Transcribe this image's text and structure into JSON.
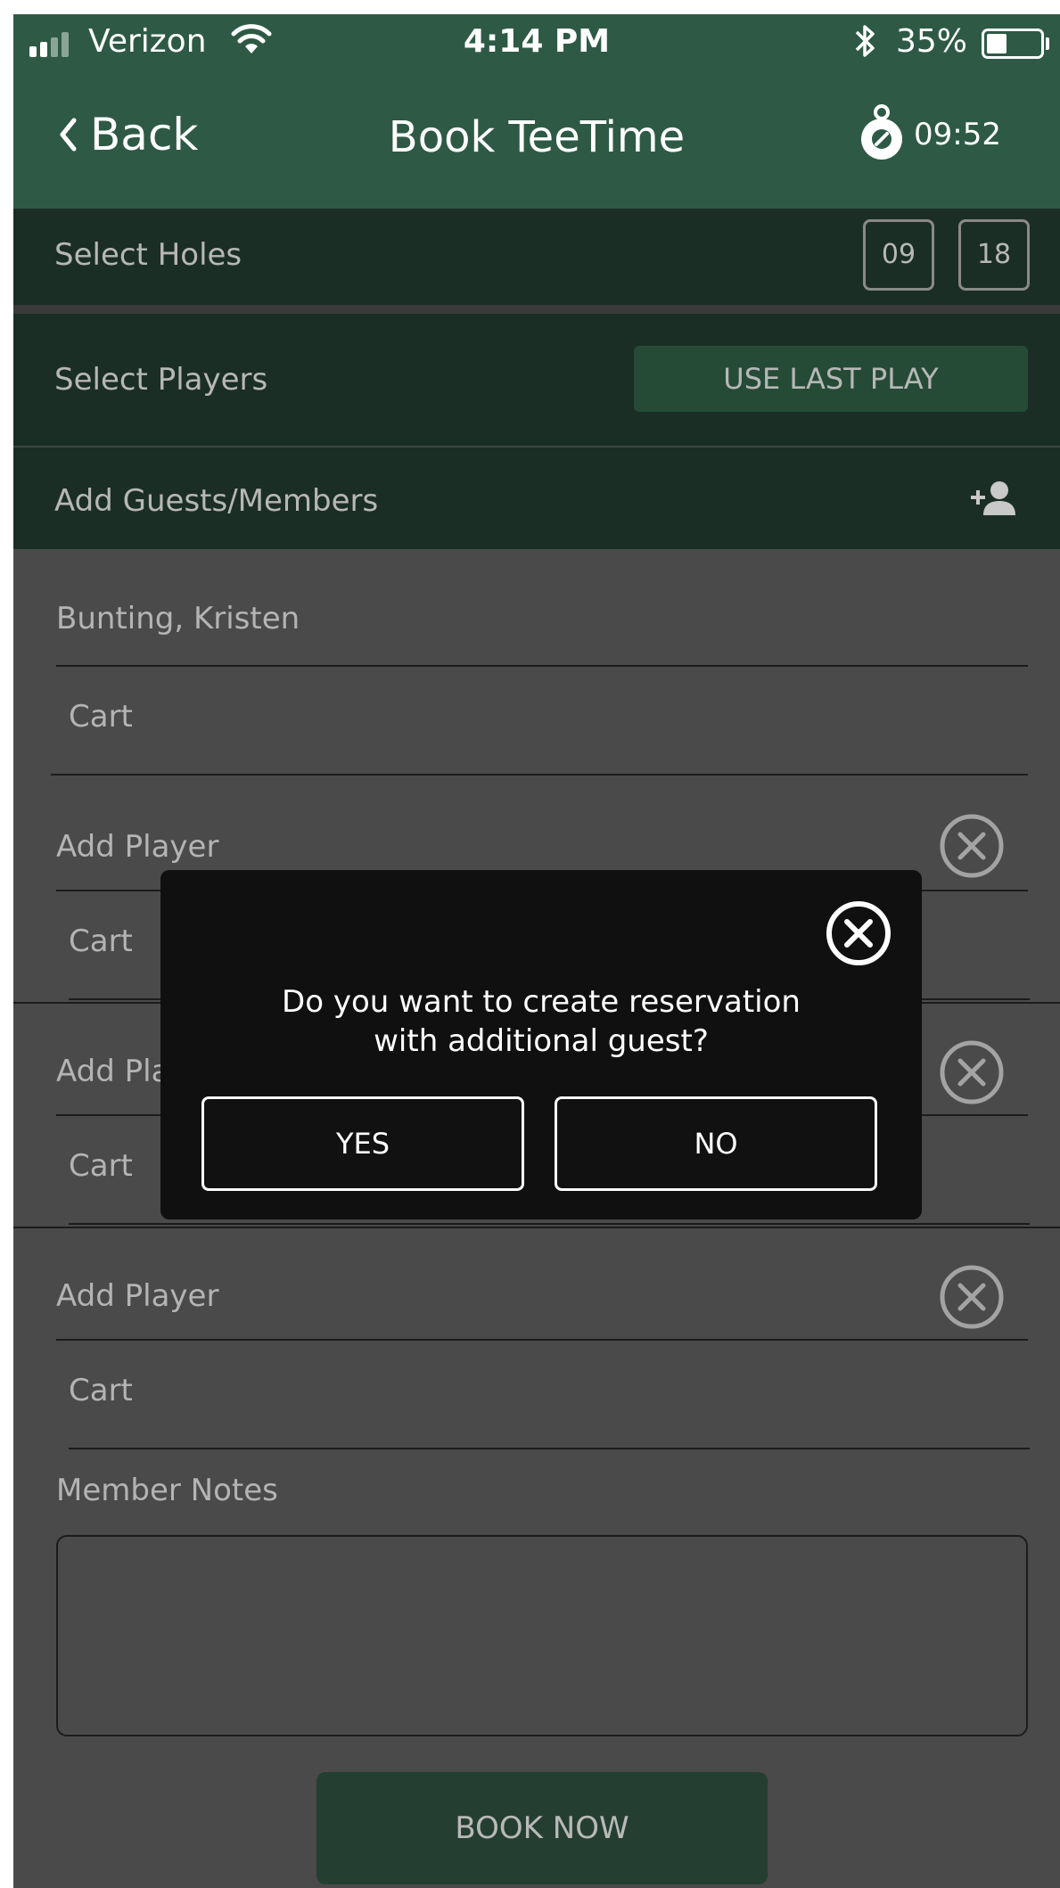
{
  "status_bar": {
    "carrier": "Verizon",
    "time": "4:14 PM",
    "battery": "35%"
  },
  "nav": {
    "back_label": "Back",
    "title": "Book TeeTime",
    "timer": "09:52"
  },
  "holes": {
    "label": "Select Holes",
    "options": [
      "09",
      "18"
    ]
  },
  "players_section": {
    "label": "Select Players",
    "use_last_play": "USE LAST PLAY"
  },
  "guests_section": {
    "label": "Add Guests/Members"
  },
  "players": [
    {
      "name": "Bunting, Kristen",
      "cart": "Cart"
    },
    {
      "name": "Add Player",
      "cart": "Cart"
    },
    {
      "name": "Add Player",
      "cart": "Cart"
    },
    {
      "name": "Add Player",
      "cart": "Cart"
    }
  ],
  "notes": {
    "label": "Member Notes",
    "value": ""
  },
  "book_button": "BOOK NOW",
  "dialog": {
    "message_line1": "Do you want to create reservation",
    "message_line2": "with additional guest?",
    "yes": "YES",
    "no": "NO"
  },
  "colors": {
    "brand_green": "#2e5a45",
    "section_bg": "#1b2e25",
    "button_green": "#254b37",
    "overlay_bg": "#4a4a4a",
    "dialog_bg": "#101010"
  }
}
